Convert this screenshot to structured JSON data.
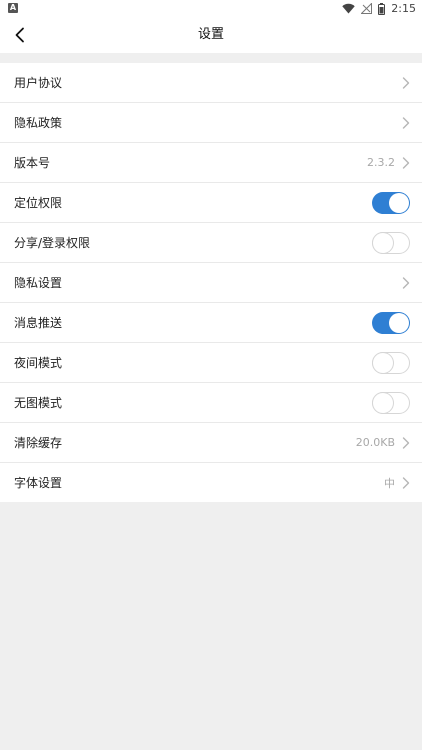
{
  "status_bar": {
    "notification_icon": "a-icon",
    "time": "2:15"
  },
  "header": {
    "title": "设置",
    "back_icon": "chevron-left-icon"
  },
  "colors": {
    "toggle_on": "#2f7fd3",
    "background": "#efefef"
  },
  "settings": [
    {
      "label": "用户协议",
      "type": "link",
      "value": ""
    },
    {
      "label": "隐私政策",
      "type": "link",
      "value": ""
    },
    {
      "label": "版本号",
      "type": "link",
      "value": "2.3.2"
    },
    {
      "label": "定位权限",
      "type": "toggle",
      "on": true
    },
    {
      "label": "分享/登录权限",
      "type": "toggle",
      "on": false
    },
    {
      "label": "隐私设置",
      "type": "link",
      "value": ""
    },
    {
      "label": "消息推送",
      "type": "toggle",
      "on": true
    },
    {
      "label": "夜间模式",
      "type": "toggle",
      "on": false
    },
    {
      "label": "无图模式",
      "type": "toggle",
      "on": false
    },
    {
      "label": "清除缓存",
      "type": "link",
      "value": "20.0KB"
    },
    {
      "label": "字体设置",
      "type": "link",
      "value": "中"
    }
  ]
}
